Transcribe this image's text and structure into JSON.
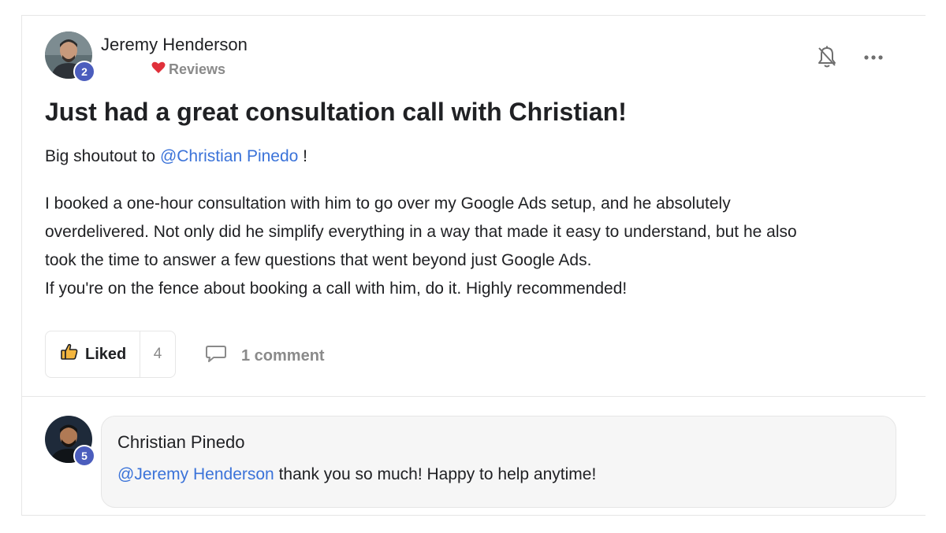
{
  "post": {
    "author_name": "Jeremy Henderson",
    "author_level": "2",
    "category": "Reviews",
    "title": "Just had a great consultation call with Christian!",
    "shoutout_prefix": "Big shoutout to ",
    "shoutout_mention": "@Christian Pinedo",
    "shoutout_suffix": " !",
    "body_lines": [
      "I booked a one-hour consultation with him to go over my Google Ads setup, and he absolutely",
      "overdelivered. Not only did he simplify everything in a way that made it easy to understand, but he also",
      "took the time to answer a few questions that went beyond just Google Ads.",
      "If you're on the fence about booking a call with him, do it. Highly recommended!"
    ],
    "like_label": "Liked",
    "like_count": "4",
    "comments_label": "1 comment"
  },
  "comment": {
    "author_name": "Christian Pinedo",
    "author_level": "5",
    "mention": "@Jeremy Henderson",
    "text": " thank you so much! Happy to help anytime!"
  },
  "icons": {
    "category_icon": "heart-icon",
    "bell": "bell-off-icon",
    "more": "more-horizontal-icon",
    "like": "thumbs-up-icon",
    "comment": "comment-bubble-icon"
  },
  "colors": {
    "mention": "#3b73d9",
    "badge": "#4b5dbd",
    "heart": "#e0303a",
    "muted": "#8a8a8a"
  }
}
